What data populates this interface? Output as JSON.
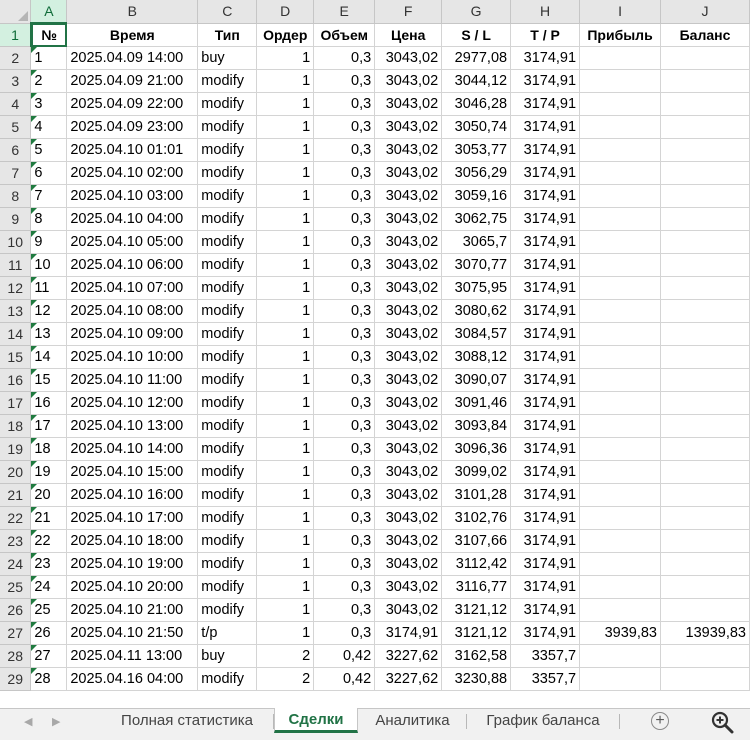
{
  "sheet": {
    "col_letters": [
      "A",
      "B",
      "C",
      "D",
      "E",
      "F",
      "G",
      "H",
      "I",
      "J"
    ],
    "headers": [
      "№",
      "Время",
      "Тип",
      "Ордер",
      "Объем",
      "Цена",
      "S / L",
      "T / P",
      "Прибыль",
      "Баланс"
    ],
    "rows": [
      [
        "1",
        "2025.04.09 14:00",
        "buy",
        "1",
        "0,3",
        "3043,02",
        "2977,08",
        "3174,91",
        "",
        ""
      ],
      [
        "2",
        "2025.04.09 21:00",
        "modify",
        "1",
        "0,3",
        "3043,02",
        "3044,12",
        "3174,91",
        "",
        ""
      ],
      [
        "3",
        "2025.04.09 22:00",
        "modify",
        "1",
        "0,3",
        "3043,02",
        "3046,28",
        "3174,91",
        "",
        ""
      ],
      [
        "4",
        "2025.04.09 23:00",
        "modify",
        "1",
        "0,3",
        "3043,02",
        "3050,74",
        "3174,91",
        "",
        ""
      ],
      [
        "5",
        "2025.04.10 01:01",
        "modify",
        "1",
        "0,3",
        "3043,02",
        "3053,77",
        "3174,91",
        "",
        ""
      ],
      [
        "6",
        "2025.04.10 02:00",
        "modify",
        "1",
        "0,3",
        "3043,02",
        "3056,29",
        "3174,91",
        "",
        ""
      ],
      [
        "7",
        "2025.04.10 03:00",
        "modify",
        "1",
        "0,3",
        "3043,02",
        "3059,16",
        "3174,91",
        "",
        ""
      ],
      [
        "8",
        "2025.04.10 04:00",
        "modify",
        "1",
        "0,3",
        "3043,02",
        "3062,75",
        "3174,91",
        "",
        ""
      ],
      [
        "9",
        "2025.04.10 05:00",
        "modify",
        "1",
        "0,3",
        "3043,02",
        "3065,7",
        "3174,91",
        "",
        ""
      ],
      [
        "10",
        "2025.04.10 06:00",
        "modify",
        "1",
        "0,3",
        "3043,02",
        "3070,77",
        "3174,91",
        "",
        ""
      ],
      [
        "11",
        "2025.04.10 07:00",
        "modify",
        "1",
        "0,3",
        "3043,02",
        "3075,95",
        "3174,91",
        "",
        ""
      ],
      [
        "12",
        "2025.04.10 08:00",
        "modify",
        "1",
        "0,3",
        "3043,02",
        "3080,62",
        "3174,91",
        "",
        ""
      ],
      [
        "13",
        "2025.04.10 09:00",
        "modify",
        "1",
        "0,3",
        "3043,02",
        "3084,57",
        "3174,91",
        "",
        ""
      ],
      [
        "14",
        "2025.04.10 10:00",
        "modify",
        "1",
        "0,3",
        "3043,02",
        "3088,12",
        "3174,91",
        "",
        ""
      ],
      [
        "15",
        "2025.04.10 11:00",
        "modify",
        "1",
        "0,3",
        "3043,02",
        "3090,07",
        "3174,91",
        "",
        ""
      ],
      [
        "16",
        "2025.04.10 12:00",
        "modify",
        "1",
        "0,3",
        "3043,02",
        "3091,46",
        "3174,91",
        "",
        ""
      ],
      [
        "17",
        "2025.04.10 13:00",
        "modify",
        "1",
        "0,3",
        "3043,02",
        "3093,84",
        "3174,91",
        "",
        ""
      ],
      [
        "18",
        "2025.04.10 14:00",
        "modify",
        "1",
        "0,3",
        "3043,02",
        "3096,36",
        "3174,91",
        "",
        ""
      ],
      [
        "19",
        "2025.04.10 15:00",
        "modify",
        "1",
        "0,3",
        "3043,02",
        "3099,02",
        "3174,91",
        "",
        ""
      ],
      [
        "20",
        "2025.04.10 16:00",
        "modify",
        "1",
        "0,3",
        "3043,02",
        "3101,28",
        "3174,91",
        "",
        ""
      ],
      [
        "21",
        "2025.04.10 17:00",
        "modify",
        "1",
        "0,3",
        "3043,02",
        "3102,76",
        "3174,91",
        "",
        ""
      ],
      [
        "22",
        "2025.04.10 18:00",
        "modify",
        "1",
        "0,3",
        "3043,02",
        "3107,66",
        "3174,91",
        "",
        ""
      ],
      [
        "23",
        "2025.04.10 19:00",
        "modify",
        "1",
        "0,3",
        "3043,02",
        "3112,42",
        "3174,91",
        "",
        ""
      ],
      [
        "24",
        "2025.04.10 20:00",
        "modify",
        "1",
        "0,3",
        "3043,02",
        "3116,77",
        "3174,91",
        "",
        ""
      ],
      [
        "25",
        "2025.04.10 21:00",
        "modify",
        "1",
        "0,3",
        "3043,02",
        "3121,12",
        "3174,91",
        "",
        ""
      ],
      [
        "26",
        "2025.04.10 21:50",
        "t/p",
        "1",
        "0,3",
        "3174,91",
        "3121,12",
        "3174,91",
        "3939,83",
        "13939,83"
      ],
      [
        "27",
        "2025.04.11 13:00",
        "buy",
        "2",
        "0,42",
        "3227,62",
        "3162,58",
        "3357,7",
        "",
        ""
      ],
      [
        "28",
        "2025.04.16 04:00",
        "modify",
        "2",
        "0,42",
        "3227,62",
        "3230,88",
        "3357,7",
        "",
        ""
      ]
    ]
  },
  "tabs": {
    "items": [
      "Полная статистика",
      "Сделки",
      "Аналитика",
      "График баланса"
    ],
    "active_index": 1
  },
  "icons": {
    "prev": "scroll-left-icon",
    "next": "scroll-right-icon",
    "add": "add-sheet-icon",
    "zoom": "zoom-in-icon"
  },
  "colors": {
    "accent": "#217346",
    "header_bg": "#e6e6e6",
    "grid": "#d4d4d4"
  }
}
